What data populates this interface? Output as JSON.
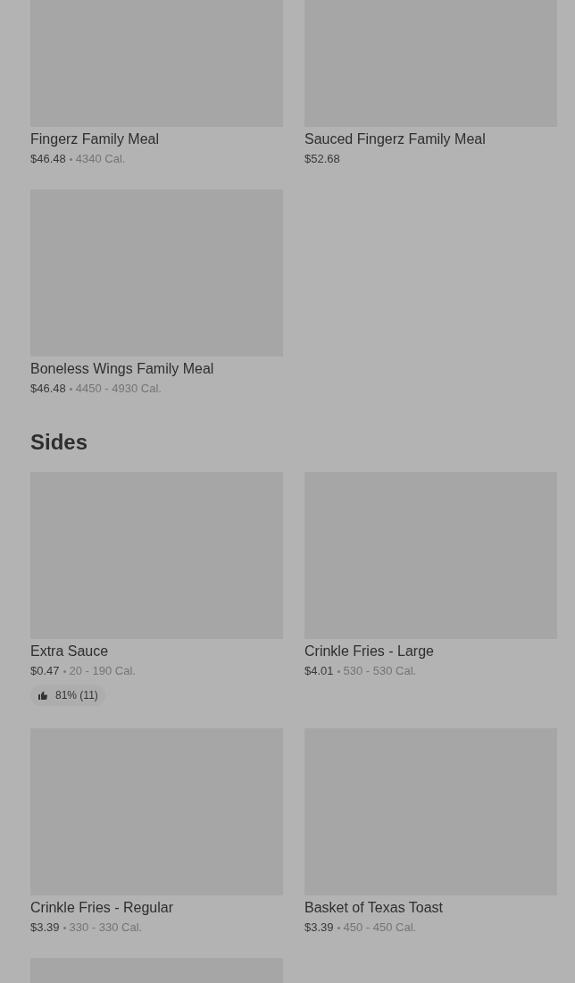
{
  "sections": [
    {
      "items": [
        {
          "kind": "product",
          "name": "Fingerz Family Meal",
          "price": "$46.48",
          "calories": "4340 Cal."
        },
        {
          "kind": "product",
          "name": "Sauced Fingerz Family Meal",
          "price": "$52.68"
        },
        {
          "kind": "product",
          "name": "Boneless Wings Family Meal",
          "price": "$46.48",
          "calories": "4450 - 4930 Cal."
        }
      ]
    },
    {
      "title": "Sides",
      "items": [
        {
          "kind": "product",
          "name": "Extra Sauce",
          "price": "$0.47",
          "calories": "20 - 190 Cal.",
          "rating": "81% (11)"
        },
        {
          "kind": "product",
          "name": "Crinkle Fries - Large",
          "price": "$4.01",
          "calories": "530 - 530 Cal."
        },
        {
          "kind": "product",
          "name": "Crinkle Fries - Regular",
          "price": "$3.39",
          "calories": "330 - 330 Cal."
        },
        {
          "kind": "product",
          "name": "Basket of Texas Toast",
          "price": "$3.39",
          "calories": "450 - 450 Cal."
        },
        {
          "kind": "picture"
        }
      ]
    }
  ]
}
